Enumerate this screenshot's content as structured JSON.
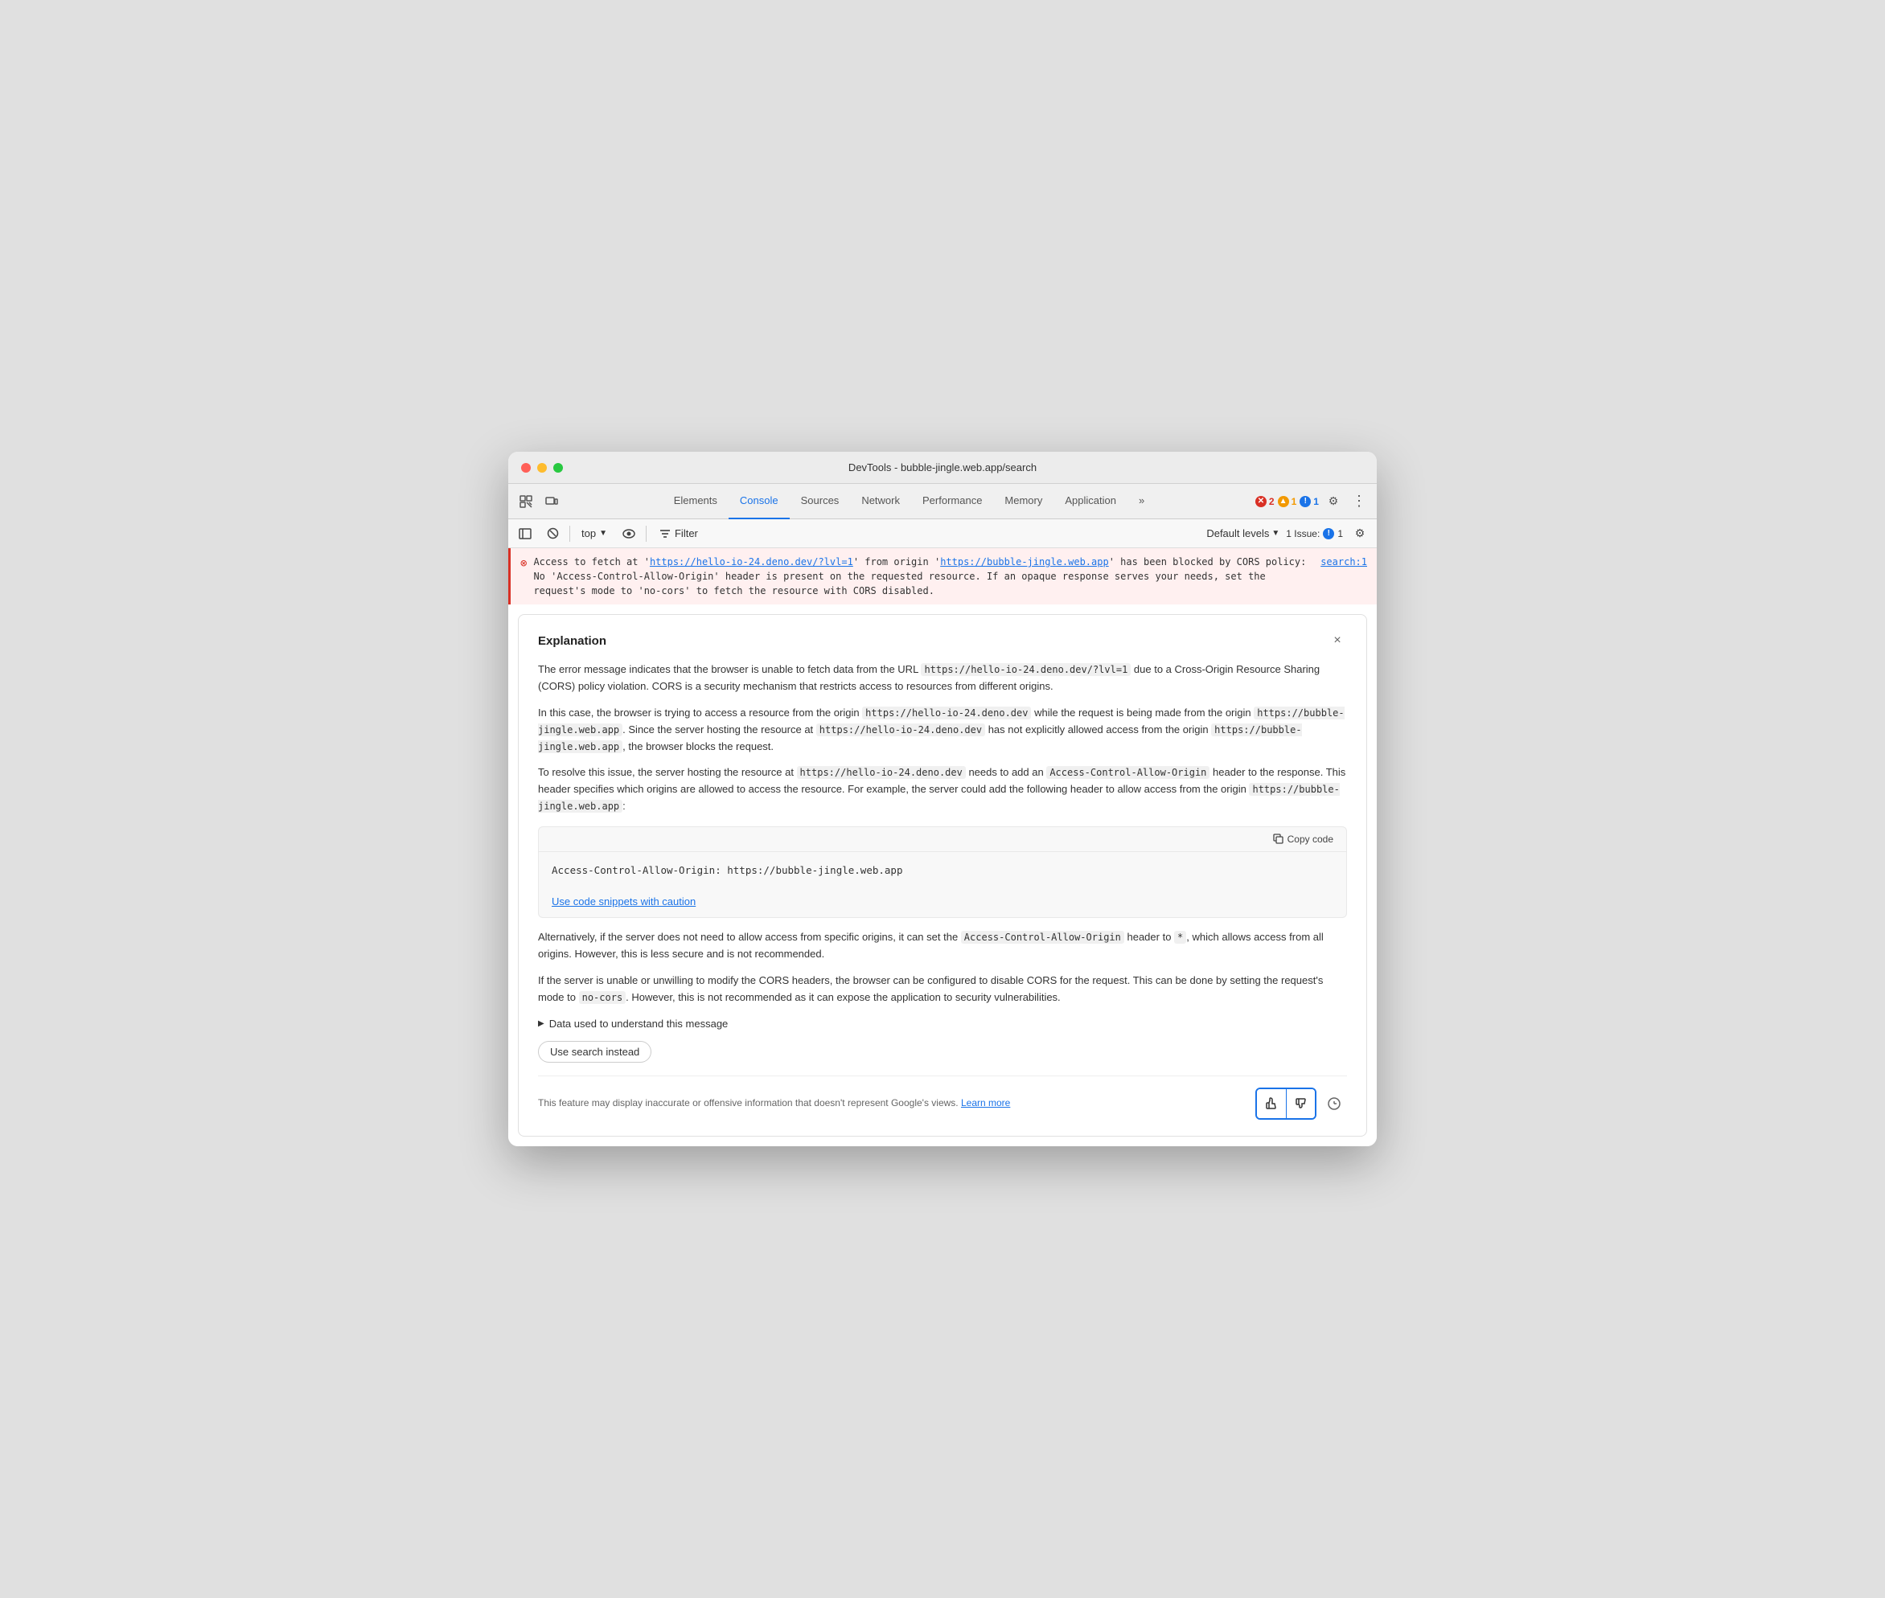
{
  "window": {
    "title": "DevTools - bubble-jingle.web.app/search"
  },
  "tabs": {
    "items": [
      {
        "label": "Elements",
        "active": false
      },
      {
        "label": "Console",
        "active": true
      },
      {
        "label": "Sources",
        "active": false
      },
      {
        "label": "Network",
        "active": false
      },
      {
        "label": "Performance",
        "active": false
      },
      {
        "label": "Memory",
        "active": false
      },
      {
        "label": "Application",
        "active": false
      }
    ],
    "more_label": "»"
  },
  "toolbar": {
    "top_label": "top",
    "filter_label": "Filter",
    "default_levels_label": "Default levels",
    "issues_label": "1 Issue:",
    "issues_count": "1"
  },
  "error_line": {
    "prefix": "Access to fetch at '",
    "url1": "https://hello-io-24.deno.dev/?lvl=1",
    "middle": "' from origin '",
    "url2": "https://bubble-jingle.web.app",
    "suffix": "' has been blocked by CORS policy: No 'Access-Control-Allow-Origin' header is present on the requested resource. If an opaque response serves your needs, set the request's mode to 'no-cors' to fetch the resource with CORS disabled.",
    "source": "search:1"
  },
  "explanation": {
    "title": "Explanation",
    "close_label": "×",
    "para1": "The error message indicates that the browser is unable to fetch data from the URL ",
    "para1_url": "https://hello-io-24.deno.dev/?lvl=1",
    "para1_end": " due to a Cross-Origin Resource Sharing (CORS) policy violation. CORS is a security mechanism that restricts access to resources from different origins.",
    "para2_start": "In this case, the browser is trying to access a resource from the origin ",
    "para2_code1": "https://hello-io-24.deno.dev",
    "para2_mid1": " while the request is being made from the origin ",
    "para2_code2": "https://bubble-jingle.web.app",
    "para2_mid2": ". Since the server hosting the resource at ",
    "para2_code3": "https://hello-io-24.deno.dev",
    "para2_end1": " has not explicitly allowed access from the origin ",
    "para2_code4": "https://bubble-jingle.web.app",
    "para2_end2": ", the browser blocks the request.",
    "para3_start": "To resolve this issue, the server hosting the resource at ",
    "para3_code1": "https://hello-io-24.deno.dev",
    "para3_mid1": " needs to add an ",
    "para3_code2": "Access-Control-Allow-Origin",
    "para3_mid2": " header to the response. This header specifies which origins are allowed to access the resource. For example, the server could add the following header to allow access from the origin ",
    "para3_code3": "https://bubble-jingle.web.app",
    "para3_end": ":",
    "code_snippet": "Access-Control-Allow-Origin: https://bubble-jingle.web.app",
    "copy_code_label": "Copy code",
    "caution_label": "Use code snippets with caution",
    "para4_start": "Alternatively, if the server does not need to allow access from specific origins, it can set the ",
    "para4_code1": "Access-Control-Allow-Origin",
    "para4_mid1": " header to ",
    "para4_code2": "*",
    "para4_end": ", which allows access from all origins. However, this is less secure and is not recommended.",
    "para5_start": "If the server is unable or unwilling to modify the CORS headers, the browser can be configured to disable CORS for the request. This can be done by setting the request's mode to ",
    "para5_code1": "no-cors",
    "para5_end": ". However, this is not recommended as it can expose the application to security vulnerabilities.",
    "data_section_label": "Data used to understand this message",
    "use_search_label": "Use search instead",
    "feedback_text": "This feature may display inaccurate or offensive information that doesn't represent Google's views.",
    "learn_more_label": "Learn more"
  },
  "badge_counts": {
    "errors": "2",
    "warnings": "1",
    "issues": "1"
  }
}
